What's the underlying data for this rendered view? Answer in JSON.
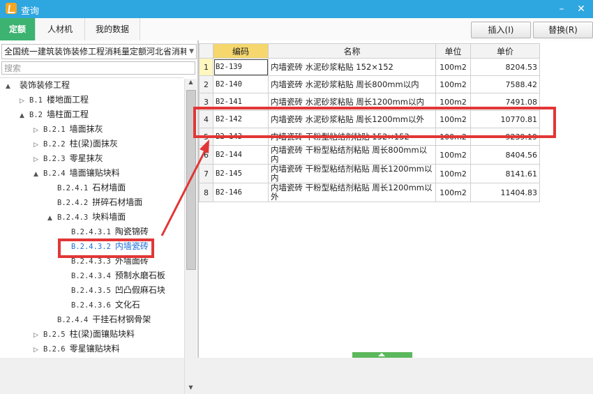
{
  "window": {
    "title": "查询",
    "minimize_label": "–",
    "close_label": "✕"
  },
  "tabs": [
    "定额",
    "人材机",
    "我的数据"
  ],
  "toolbar": {
    "insert_label": "插入(I)",
    "replace_label": "替换(R)"
  },
  "library_select": {
    "value": "全国统一建筑装饰装修工程消耗量定额河北省消耗"
  },
  "search": {
    "placeholder": "搜索"
  },
  "tree": [
    {
      "indent": 0,
      "toggle": "▲",
      "code": "",
      "label": "装饰装修工程"
    },
    {
      "indent": 1,
      "toggle": "▷",
      "code": "B.1",
      "label": "楼地面工程"
    },
    {
      "indent": 1,
      "toggle": "▲",
      "code": "B.2",
      "label": "墙柱面工程"
    },
    {
      "indent": 2,
      "toggle": "▷",
      "code": "B.2.1",
      "label": "墙面抹灰"
    },
    {
      "indent": 2,
      "toggle": "▷",
      "code": "B.2.2",
      "label": "柱(梁)面抹灰"
    },
    {
      "indent": 2,
      "toggle": "▷",
      "code": "B.2.3",
      "label": "零星抹灰"
    },
    {
      "indent": 2,
      "toggle": "▲",
      "code": "B.2.4",
      "label": "墙面镶贴块料"
    },
    {
      "indent": 3,
      "toggle": "",
      "code": "B.2.4.1",
      "label": "石材墙面"
    },
    {
      "indent": 3,
      "toggle": "",
      "code": "B.2.4.2",
      "label": "拼碎石材墙面"
    },
    {
      "indent": 3,
      "toggle": "▲",
      "code": "B.2.4.3",
      "label": "块料墙面"
    },
    {
      "indent": 4,
      "toggle": "",
      "code": "B.2.4.3.1",
      "label": "陶瓷锦砖"
    },
    {
      "indent": 4,
      "toggle": "",
      "code": "B.2.4.3.2",
      "label": "内墙瓷砖",
      "selected": true
    },
    {
      "indent": 4,
      "toggle": "",
      "code": "B.2.4.3.3",
      "label": "外墙面砖"
    },
    {
      "indent": 4,
      "toggle": "",
      "code": "B.2.4.3.4",
      "label": "预制水磨石板"
    },
    {
      "indent": 4,
      "toggle": "",
      "code": "B.2.4.3.5",
      "label": "凹凸假麻石块"
    },
    {
      "indent": 4,
      "toggle": "",
      "code": "B.2.4.3.6",
      "label": "文化石"
    },
    {
      "indent": 3,
      "toggle": "",
      "code": "B.2.4.4",
      "label": "干挂石材钢骨架"
    },
    {
      "indent": 2,
      "toggle": "▷",
      "code": "B.2.5",
      "label": "柱(梁)面镶贴块料"
    },
    {
      "indent": 2,
      "toggle": "▷",
      "code": "B.2.6",
      "label": "零星镶贴块料"
    }
  ],
  "table": {
    "headers": [
      "",
      "编码",
      "名称",
      "单位",
      "单价"
    ],
    "rows": [
      {
        "idx": "1",
        "code": "B2-139",
        "name": "内墙瓷砖 水泥砂浆粘贴 152×152",
        "unit": "100m2",
        "price": "8204.53"
      },
      {
        "idx": "2",
        "code": "B2-140",
        "name": "内墙瓷砖 水泥砂浆粘贴 周长800mm以内",
        "unit": "100m2",
        "price": "7588.42"
      },
      {
        "idx": "3",
        "code": "B2-141",
        "name": "内墙瓷砖 水泥砂浆粘贴 周长1200mm以内",
        "unit": "100m2",
        "price": "7491.08"
      },
      {
        "idx": "4",
        "code": "B2-142",
        "name": "内墙瓷砖 水泥砂浆粘贴 周长1200mm以外",
        "unit": "100m2",
        "price": "10770.81"
      },
      {
        "idx": "5",
        "code": "B2-143",
        "name": "内墙瓷砖 干粉型粘结剂粘贴 152×152",
        "unit": "100m2",
        "price": "9239.19"
      },
      {
        "idx": "6",
        "code": "B2-144",
        "name": "内墙瓷砖 干粉型粘结剂粘贴 周长800mm以内",
        "unit": "100m2",
        "price": "8404.56"
      },
      {
        "idx": "7",
        "code": "B2-145",
        "name": "内墙瓷砖 干粉型粘结剂粘贴 周长1200mm以内",
        "unit": "100m2",
        "price": "8141.61"
      },
      {
        "idx": "8",
        "code": "B2-146",
        "name": "内墙瓷砖 干粉型粘结剂粘贴 周长1200mm以外",
        "unit": "100m2",
        "price": "11404.83"
      }
    ]
  },
  "colors": {
    "titlebar": "#2ea6df",
    "active_tab": "#3cb371",
    "highlight": "#e23636",
    "selected_text": "#1e6fd9"
  }
}
